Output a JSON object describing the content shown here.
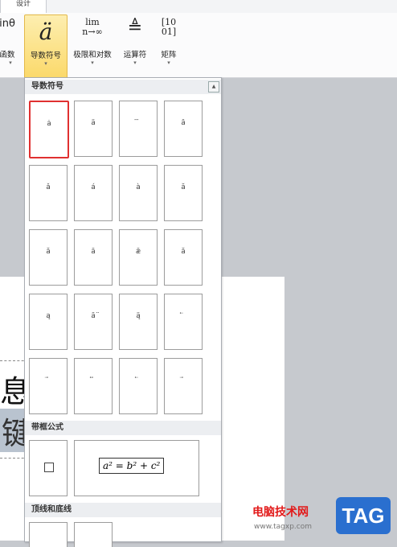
{
  "ribbon": {
    "tab": "设计",
    "buttons": [
      {
        "id": "func",
        "glyph": "inθ",
        "label": "函数"
      },
      {
        "id": "deriv",
        "glyph": "ä",
        "label": "导数符号",
        "active": true
      },
      {
        "id": "limit",
        "glyph": "lim\nn→∞",
        "label": "极限和对数"
      },
      {
        "id": "op",
        "glyph": "≜",
        "label": "运算符"
      },
      {
        "id": "matrix",
        "glyph": "[10\n01]",
        "label": "矩阵"
      }
    ],
    "dropdown_arrow": "▾"
  },
  "menu": {
    "sections": [
      {
        "title": "导数符号"
      },
      {
        "title": "带框公式"
      },
      {
        "title": "顶线和底线"
      }
    ],
    "scroll_up": "▲",
    "accent_symbols": [
      "ȧ",
      "ä",
      "⃛",
      "ȃ",
      "ǎ",
      "á",
      "à",
      "ă",
      "ă",
      "ā",
      "ǣ",
      "ă",
      "ą",
      "ā̈",
      "ą̈",
      "⃖",
      "⃗",
      "⃡",
      "⃖",
      "⃗"
    ],
    "boxed_formula": "a² = b² + c²"
  },
  "document": {
    "line1": "息",
    "line2": "键"
  },
  "watermark": {
    "text": "电脑技术网",
    "url": "www.tagxp.com",
    "badge": "TAG"
  },
  "colors": {
    "active_button": "#fbd96a",
    "selection_border": "#e03030",
    "badge": "#2a6fcf"
  }
}
